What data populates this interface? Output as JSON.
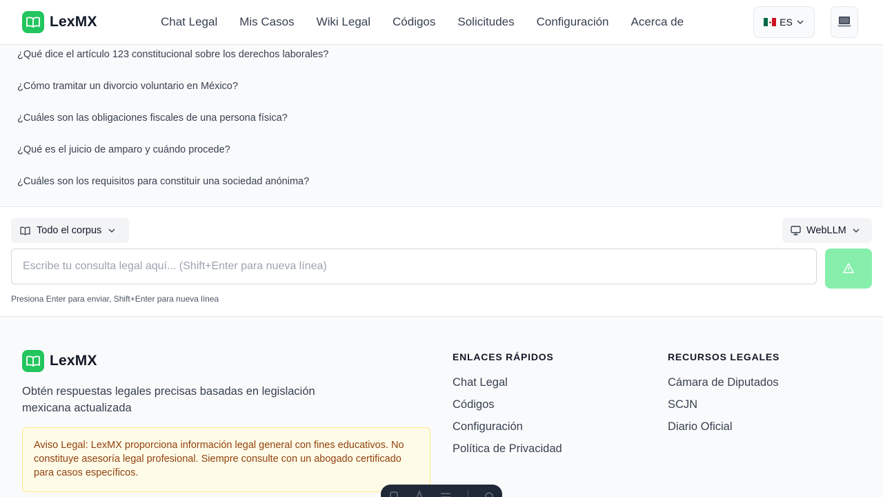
{
  "header": {
    "brand": "LexMX",
    "nav": [
      "Chat Legal",
      "Mis Casos",
      "Wiki Legal",
      "Códigos",
      "Solicitudes",
      "Configuración",
      "Acerca de"
    ],
    "language": "ES",
    "icons": {
      "logo": "book-open-icon",
      "language_flag": "mexico-flag-icon",
      "theme": "laptop-icon"
    }
  },
  "suggestions": [
    "¿Qué dice el artículo 123 constitucional sobre los derechos laborales?",
    "¿Cómo tramitar un divorcio voluntario en México?",
    "¿Cuáles son las obligaciones fiscales de una persona física?",
    "¿Qué es el juicio de amparo y cuándo procede?",
    "¿Cuáles son los requisitos para constituir una sociedad anónima?"
  ],
  "chat_input": {
    "corpus_label": "Todo el corpus",
    "model_label": "WebLLM",
    "placeholder": "Escribe tu consulta legal aquí... (Shift+Enter para nueva línea)",
    "value": "",
    "hint": "Presiona Enter para enviar, Shift+Enter para nueva línea",
    "send_disabled": true
  },
  "footer": {
    "brand": "LexMX",
    "description": "Obtén respuestas legales precisas basadas en legislación mexicana actualizada",
    "disclaimer": "Aviso Legal: LexMX proporciona información legal general con fines educativos. No constituye asesoría legal profesional. Siempre consulte con un abogado certificado para casos específicos.",
    "quick_links_title": "ENLACES RÁPIDOS",
    "quick_links": [
      "Chat Legal",
      "Códigos",
      "Configuración",
      "Política de Privacidad"
    ],
    "resources_title": "RECURSOS LEGALES",
    "resources": [
      "Cámara de Diputados",
      "SCJN",
      "Diario Oficial"
    ]
  },
  "colors": {
    "brand": "#22c55e",
    "send_disabled": "#86efac",
    "disclaimer_bg": "#fefce8",
    "disclaimer_text": "#92400e"
  }
}
